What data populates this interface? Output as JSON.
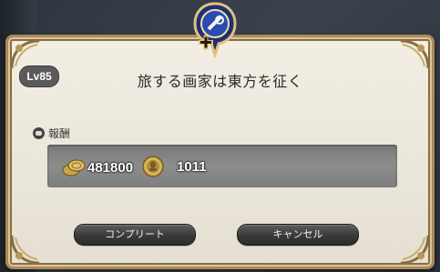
{
  "dialog": {
    "level": "Lv85",
    "title": "旅する画家は東方を征く",
    "reward_heading": "報酬",
    "rewards": [
      {
        "icon": "gil-icon",
        "value": "481800"
      },
      {
        "icon": "scrip-icon",
        "value": "1011"
      }
    ],
    "complete_label": "コンプリート",
    "cancel_label": "キャンセル"
  },
  "colors": {
    "frame_gold": "#a88b58",
    "panel_bg": "#f2eee4",
    "emblem_blue": "#2a4bb0",
    "button_dark": "#3a3a3a"
  }
}
